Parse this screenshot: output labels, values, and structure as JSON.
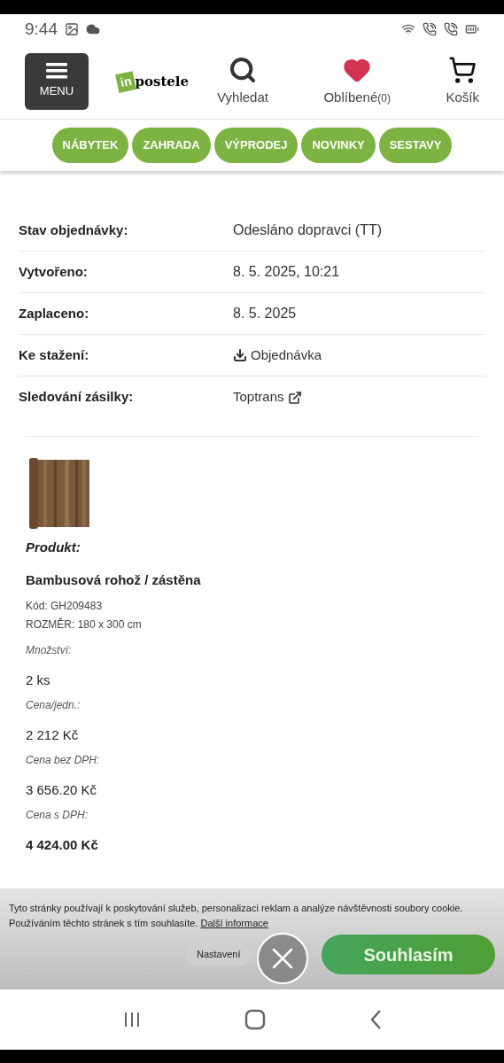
{
  "status_bar": {
    "time": "9:44"
  },
  "header": {
    "menu_label": "MENU",
    "logo": {
      "badge": "in",
      "name": "postele"
    },
    "actions": [
      {
        "kind": "search",
        "label": "Vyhledat"
      },
      {
        "kind": "favorites",
        "label": "Oblíbené",
        "count": "(0)"
      },
      {
        "kind": "cart",
        "label": "Košík"
      }
    ]
  },
  "categories": [
    {
      "label": "NÁBYTEK"
    },
    {
      "label": "ZAHRADA"
    },
    {
      "label": "VÝPRODEJ"
    },
    {
      "label": "NOVINKY"
    },
    {
      "label": "SESTAVY"
    }
  ],
  "order_details": [
    {
      "kind": "text",
      "label": "Stav objednávky:",
      "value": "Odesláno dopravci (TT)"
    },
    {
      "kind": "text",
      "label": "Vytvořeno:",
      "value": "8. 5. 2025, 10:21"
    },
    {
      "kind": "text",
      "label": "Zaplaceno:",
      "value": "8. 5. 2025"
    },
    {
      "kind": "download",
      "label": "Ke stažení:",
      "value": "Objednávka"
    },
    {
      "kind": "external",
      "label": "Sledování zásilky:",
      "value": "Toptrans"
    }
  ],
  "product": {
    "heading": "Produkt:",
    "name": "Bambusová rohož / zástěna",
    "meta": [
      "Kód: GH209483",
      "ROZMĚR: 180 x 300 cm"
    ],
    "fields": [
      {
        "label": "Množství:",
        "value": "2 ks",
        "bold": false
      },
      {
        "label": "Cena/jedn.:",
        "value": "2 212 Kč",
        "bold": false
      },
      {
        "label": "Cena bez DPH:",
        "value": "3 656.20 Kč",
        "bold": false
      },
      {
        "label": "Cena s DPH:",
        "value": "4 424.00 Kč",
        "bold": true
      }
    ]
  },
  "cookie_banner": {
    "text": "Tyto stránky používají k poskytování služeb, personalizaci reklam a analýze návštěvnosti soubory cookie. Používáním těchto stránek s tím souhlasíte.",
    "link": "Další informace",
    "settings": "Nastavení",
    "accept": "Souhlasím"
  }
}
